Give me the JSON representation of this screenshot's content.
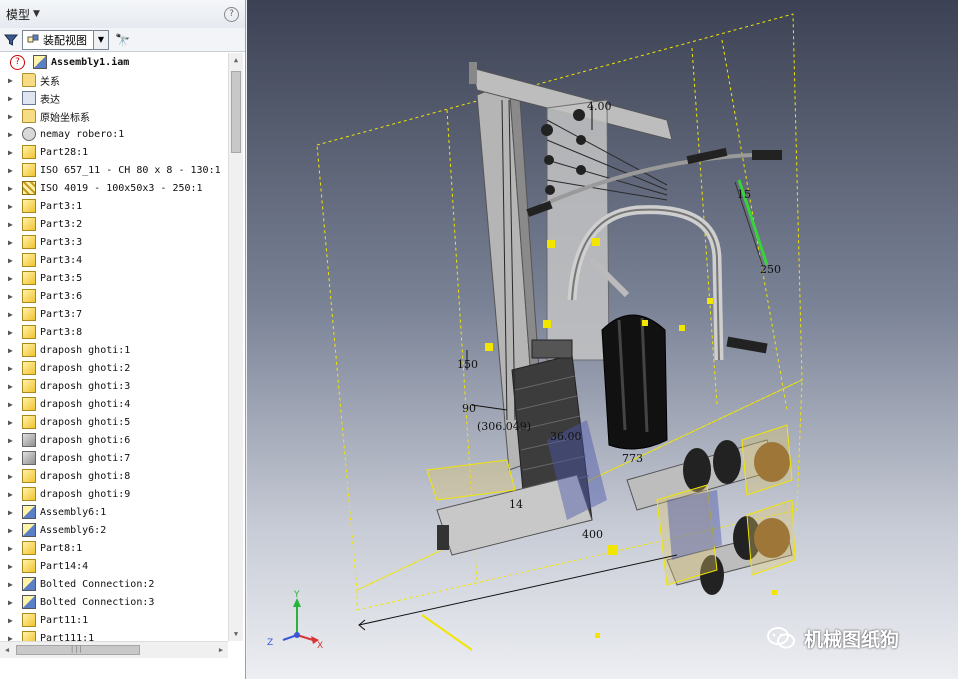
{
  "panel": {
    "title": "模型",
    "help": "?",
    "view_label": "装配视图"
  },
  "tree": {
    "root": "Assembly1.iam",
    "items": [
      {
        "label": "关系",
        "icon": "folder"
      },
      {
        "label": "表达",
        "icon": "view"
      },
      {
        "label": "原始坐标系",
        "icon": "folder"
      },
      {
        "label": "nemay robero:1",
        "icon": "circ"
      },
      {
        "label": "Part28:1",
        "icon": "part"
      },
      {
        "label": "ISO 657_11 - CH 80 x 8 - 130:1",
        "icon": "part"
      },
      {
        "label": "ISO 4019 - 100x50x3 - 250:1",
        "icon": "hatch"
      },
      {
        "label": "Part3:1",
        "icon": "part"
      },
      {
        "label": "Part3:2",
        "icon": "part"
      },
      {
        "label": "Part3:3",
        "icon": "part"
      },
      {
        "label": "Part3:4",
        "icon": "part"
      },
      {
        "label": "Part3:5",
        "icon": "part"
      },
      {
        "label": "Part3:6",
        "icon": "part"
      },
      {
        "label": "Part3:7",
        "icon": "part"
      },
      {
        "label": "Part3:8",
        "icon": "part"
      },
      {
        "label": "draposh ghoti:1",
        "icon": "part"
      },
      {
        "label": "draposh ghoti:2",
        "icon": "part"
      },
      {
        "label": "draposh ghoti:3",
        "icon": "part"
      },
      {
        "label": "draposh ghoti:4",
        "icon": "part"
      },
      {
        "label": "draposh ghoti:5",
        "icon": "part"
      },
      {
        "label": "draposh ghoti:6",
        "icon": "gray"
      },
      {
        "label": "draposh ghoti:7",
        "icon": "gray"
      },
      {
        "label": "draposh ghoti:8",
        "icon": "part"
      },
      {
        "label": "draposh ghoti:9",
        "icon": "part"
      },
      {
        "label": "Assembly6:1",
        "icon": "asm"
      },
      {
        "label": "Assembly6:2",
        "icon": "asm"
      },
      {
        "label": "Part8:1",
        "icon": "part"
      },
      {
        "label": "Part14:4",
        "icon": "part"
      },
      {
        "label": "Bolted Connection:2",
        "icon": "asm"
      },
      {
        "label": "Bolted Connection:3",
        "icon": "asm"
      },
      {
        "label": "Part11:1",
        "icon": "part"
      },
      {
        "label": "Part111:1",
        "icon": "part"
      }
    ]
  },
  "viewport": {
    "dimensions": [
      "4.00",
      "15",
      "250",
      "150",
      "90",
      "(306.049)",
      "36.00",
      "773",
      "14",
      "400"
    ],
    "axes": {
      "x": "X",
      "y": "Y",
      "z": "Z"
    }
  },
  "watermark": "机械图纸狗",
  "colors": {
    "accent": "#f2e600",
    "background_top": "#3c4253",
    "background_bottom": "#eceef2"
  }
}
